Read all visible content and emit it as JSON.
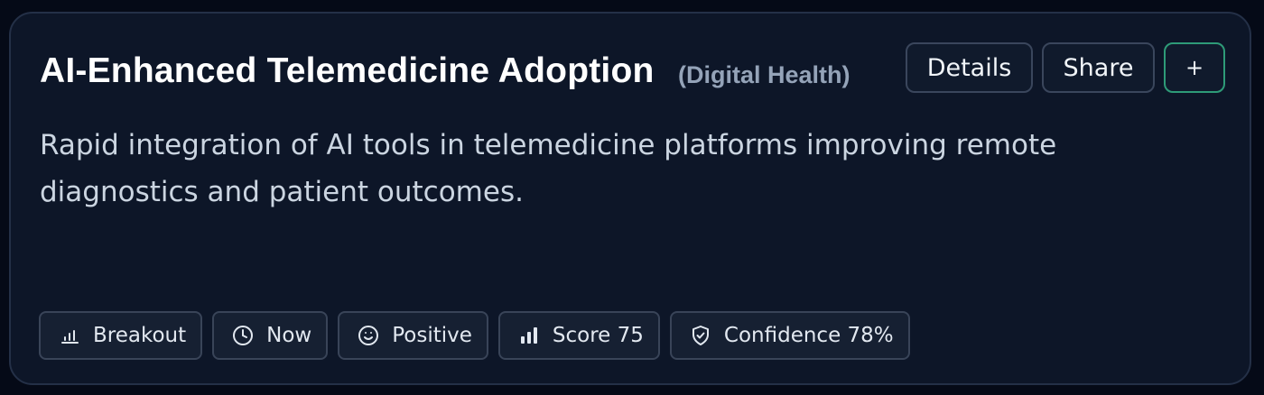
{
  "card": {
    "title": "AI-Enhanced Telemedicine Adoption",
    "category": "(Digital Health)",
    "description": "Rapid integration of AI tools in telemedicine platforms improving remote diagnostics and patient outcomes.",
    "actions": {
      "details_label": "Details",
      "share_label": "Share",
      "add_label": "+"
    },
    "tags": [
      {
        "icon": "bar-chart-icon",
        "label": "Breakout"
      },
      {
        "icon": "clock-icon",
        "label": "Now"
      },
      {
        "icon": "smiley-icon",
        "label": "Positive"
      },
      {
        "icon": "signal-bars-icon",
        "label": "Score 75"
      },
      {
        "icon": "shield-check-icon",
        "label": "Confidence 78%"
      }
    ]
  },
  "colors": {
    "background": "#050a17",
    "card": "#0d1628",
    "accent": "#2e9b78",
    "text_primary": "#ffffff",
    "text_muted": "#94a3b8"
  }
}
